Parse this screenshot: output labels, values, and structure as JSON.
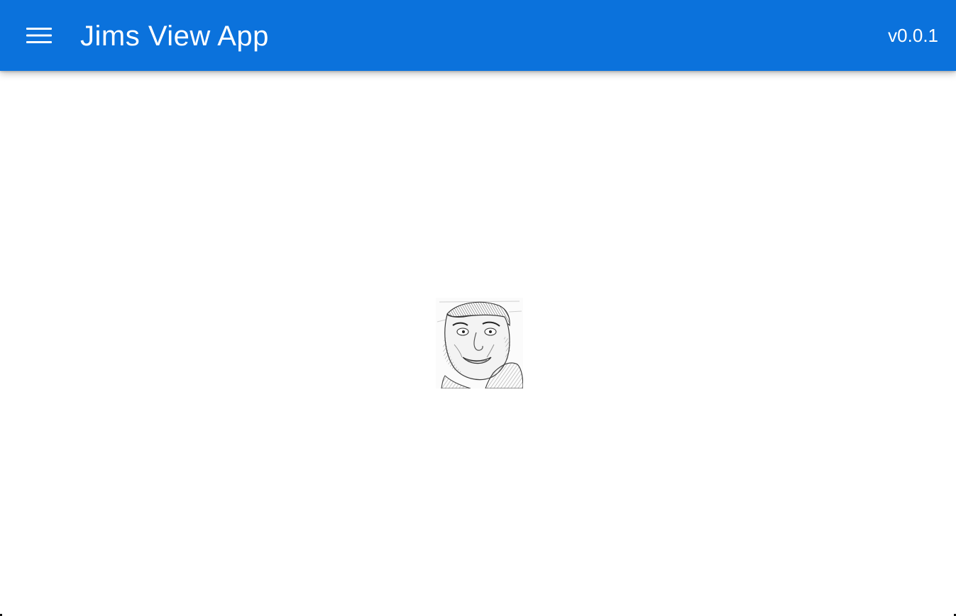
{
  "app_bar": {
    "title": "Jims View App",
    "version": "v0.0.1",
    "menu_icon": "hamburger-menu-icon",
    "background_color": "#0b72dc",
    "text_color": "#ffffff"
  },
  "content": {
    "image_icon": "sketch-portrait-image",
    "background_color": "#ffffff"
  }
}
